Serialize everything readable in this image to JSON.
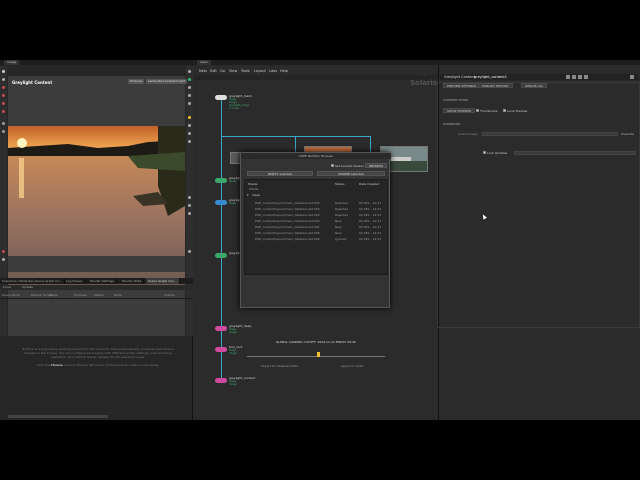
{
  "left_pane": {
    "tab_label": "image",
    "viewer_title": "Greylight Content",
    "viewer_buttons": [
      "Photo(s)",
      "Laminated Ambient light"
    ],
    "lower_tabs": [
      "Scenarios / Node Rev...",
      "Scene Graph Co...",
      "Log Viewer",
      "Render Settings",
      "Render Stats",
      "Scene Graph Con..."
    ],
    "lower_tab_selected": "Scene Graph Con...",
    "lower_tool_labels": [
      "Local",
      "Update"
    ],
    "column_headers": [
      "Scene Node",
      "Planner Script",
      "Stage",
      "Progress",
      "Status",
      "Node",
      "Cutline"
    ],
    "info_line1": "To think is a proprietary working model from the outcome, that systematically combines and renders changes in the scenes. You can configure each scene with different render settings, such as frame, resolution, and internal render updates for the selected scene.",
    "info_line2_prefix": "Click the",
    "info_line2_bold": "Choose",
    "info_line2_suffix": "menu in the top left corner of this panel to create a new dialog."
  },
  "center_pane": {
    "tab_label": "main",
    "menu": [
      "Nets",
      "Edit",
      "Go",
      "View",
      "Tools",
      "Layout",
      "Labs",
      "Help"
    ],
    "watermark": "Solaris",
    "nodes": [
      {
        "label": "greylight_load1",
        "sub": [
          "Stage",
          "Image",
          "greylight_Image",
          "0 cooks"
        ],
        "color": "#dddddd"
      },
      {
        "label": "greylight_",
        "sub": [
          "Ready"
        ],
        "color": "#3aa86a"
      },
      {
        "label": "greylight_",
        "sub": [
          "Stage"
        ],
        "color": "#3a8ad0"
      },
      {
        "label": "greylight_",
        "sub": [
          ""
        ],
        "color": "#3aa86a"
      },
      {
        "label": "greylight_deep",
        "sub": [
          "Stage",
          "Image"
        ],
        "color": "#d04aa0"
      },
      {
        "label": "tool_rect",
        "sub": [
          "Stage",
          "Image"
        ],
        "color": "#d04aa0"
      },
      {
        "label": "greylight_content",
        "sub": [
          "Stage",
          "Image"
        ],
        "color": "#d04aa0"
      }
    ]
  },
  "dialog": {
    "title": "COPE Partition Browser",
    "dots": "· · ·",
    "field_label": "Set Current Version",
    "refresh_label": "REFRESH",
    "btn_select": "REJECT selected",
    "btn_ignore": "IGNORE selected",
    "list_headers": [
      "Shade",
      "Status",
      "Date Created"
    ],
    "group_expanded": "Shade",
    "group_label": "Ideas",
    "rows": [
      {
        "name": "DSE_content/layout/main_detailed.usd.005",
        "status": "Rejected",
        "date": "02-SE1 - 12:21"
      },
      {
        "name": "DSE_content/layout/main_detailed.usd.004",
        "status": "Rejected",
        "date": "02-SE1 - 12:21"
      },
      {
        "name": "DSE_content/layout/main_detailed.usd.003",
        "status": "Rejected",
        "date": "02-SE1 - 12:21"
      },
      {
        "name": "DSE_content/layout/main_detailed.usd.002",
        "status": "New",
        "date": "02-SE1 - 12:21"
      },
      {
        "name": "DSE_content/layout/main_detailed.usd.001",
        "status": "New",
        "date": "02-SE1 - 12:21"
      },
      {
        "name": "DSE_content/layout/main_detailed.usd.000",
        "status": "New",
        "date": "02-SE1 - 12:21"
      },
      {
        "name": "DSE_content/layout/main_detailed.usd.004",
        "status": "Ignored",
        "date": "02-SE1 - 12:21"
      }
    ],
    "loading_text": "GLOBAL LOADING CUTOFF: 2024-11-12 FRIDAY 09:45",
    "footer_left": "Import for Selected Date",
    "footer_right": "Apply for slider"
  },
  "right_pane": {
    "node_type": "Greylight Content",
    "node_name": "greylight_content1",
    "header_buttons": [
      "PREVIEW SETTINGS",
      "PUBLISH HISTORY",
      "UPDATE ALL"
    ],
    "section1": "CONTENT FILTER",
    "filter_label": "SHOW FILTERED",
    "check_thumbnails": "Thumbnails",
    "check_local_preview": "Local Preview",
    "section2": "OVERRIDES",
    "field_label": "Scene Image",
    "field_button": "Override",
    "lock_updates": "Lock Updates"
  },
  "colors": {
    "accent_wire": "#3aa8c8",
    "node_green": "#3aa86a",
    "node_pink": "#d04aa0",
    "node_blue": "#3a8ad0",
    "timeline_marker": "#f0c030"
  }
}
